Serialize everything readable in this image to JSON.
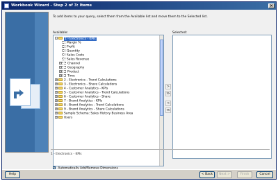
{
  "window": {
    "title": "Workbook Wizard - Step 2 of 3: Items"
  },
  "instruction": "To add items to your query, select them from the Available list and move them to the Selected list.",
  "available_label": "Available:",
  "selected_label": "Selected:",
  "tree": [
    {
      "label": "1 - Electronics - KPIs",
      "type": "folder",
      "expander": "-",
      "highlighted": true
    },
    {
      "label": "Margin %",
      "type": "measure"
    },
    {
      "label": "Profit",
      "type": "measure"
    },
    {
      "label": "Quantity",
      "type": "measure"
    },
    {
      "label": "Sales Costs",
      "type": "measure"
    },
    {
      "label": "Sales Revenue",
      "type": "measure"
    },
    {
      "label": "Channel",
      "type": "dimension",
      "expander": "+"
    },
    {
      "label": "Geography",
      "type": "dimension",
      "expander": "+"
    },
    {
      "label": "Product",
      "type": "dimension",
      "expander": "+"
    },
    {
      "label": "Time",
      "type": "dimension",
      "expander": "+"
    },
    {
      "label": "2 - Electronics - Trend Calculations",
      "type": "folder",
      "expander": "+"
    },
    {
      "label": "3 - Electronics - Share Calculations",
      "type": "folder",
      "expander": "+"
    },
    {
      "label": "4 - Customer Analytics - KPIs",
      "type": "folder",
      "expander": "+"
    },
    {
      "label": "5 - Customer Analytics - Trend Calculations",
      "type": "folder",
      "expander": "+"
    },
    {
      "label": "6 - Customer Analytics - Share",
      "type": "folder",
      "expander": "+"
    },
    {
      "label": "7 - Brand Analytics - KPIs",
      "type": "folder",
      "expander": "+"
    },
    {
      "label": "8 - Brand Analytics - Trend Calculations",
      "type": "folder",
      "expander": "+"
    },
    {
      "label": "9 - Brand Analytics - Share Calculations",
      "type": "folder",
      "expander": "+"
    },
    {
      "label": "Sample Schema: Sales History Business Area",
      "type": "folder",
      "expander": "+"
    },
    {
      "label": "Users",
      "type": "folder",
      "expander": "+"
    }
  ],
  "auto_add": {
    "label": "Automatically Add/Remove Dimensions",
    "checked": true,
    "mark": "✓"
  },
  "move_buttons": [
    {
      "glyph": ">",
      "name": "move-right-button"
    },
    {
      "glyph": "≫",
      "name": "move-all-right-button"
    },
    {
      "glyph": "<",
      "name": "move-left-button"
    },
    {
      "glyph": "≪",
      "name": "move-all-left-button"
    }
  ],
  "status_text": "1 - Electronics - KPIs",
  "footer": {
    "help": "Help",
    "back": "< Back",
    "next": "Next >",
    "finish": "Finish",
    "cancel": "Cancel"
  },
  "colors": {
    "titlebar": "#0a246a",
    "selection": "#316ac5",
    "folder": "#f2d45e"
  }
}
